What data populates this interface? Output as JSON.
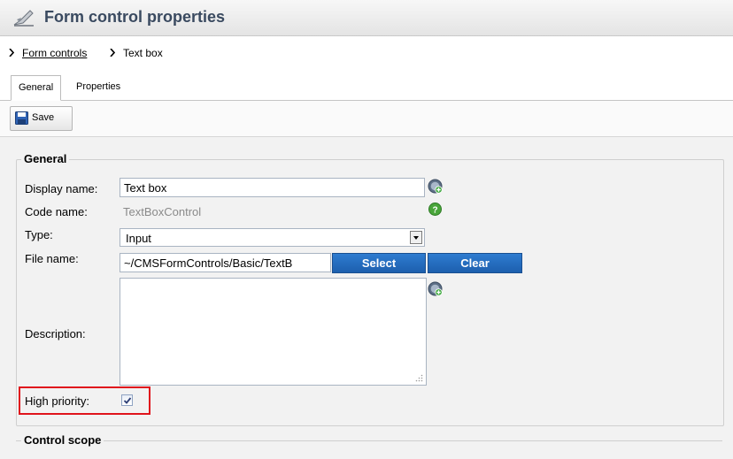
{
  "header": {
    "title": "Form control properties",
    "icon": "form-control-icon"
  },
  "breadcrumb": {
    "link": "Form controls",
    "current": "Text box"
  },
  "tabs": [
    {
      "label": "General",
      "active": true
    },
    {
      "label": "Properties",
      "active": false
    }
  ],
  "toolbar": {
    "save_label": "Save"
  },
  "general": {
    "legend": "General",
    "display_name": {
      "label": "Display name:",
      "value": "Text box"
    },
    "code_name": {
      "label": "Code name:",
      "value": "TextBoxControl"
    },
    "type": {
      "label": "Type:",
      "value": "Input"
    },
    "file_name": {
      "label": "File name:",
      "value": "~/CMSFormControls/Basic/TextB",
      "select_label": "Select",
      "clear_label": "Clear"
    },
    "description": {
      "label": "Description:",
      "value": ""
    },
    "high_priority": {
      "label": "High priority:",
      "checked": true
    }
  },
  "control_scope": {
    "legend": "Control scope"
  },
  "colors": {
    "accent_blue": "#1d5fae",
    "highlight_red": "#e0141c"
  }
}
